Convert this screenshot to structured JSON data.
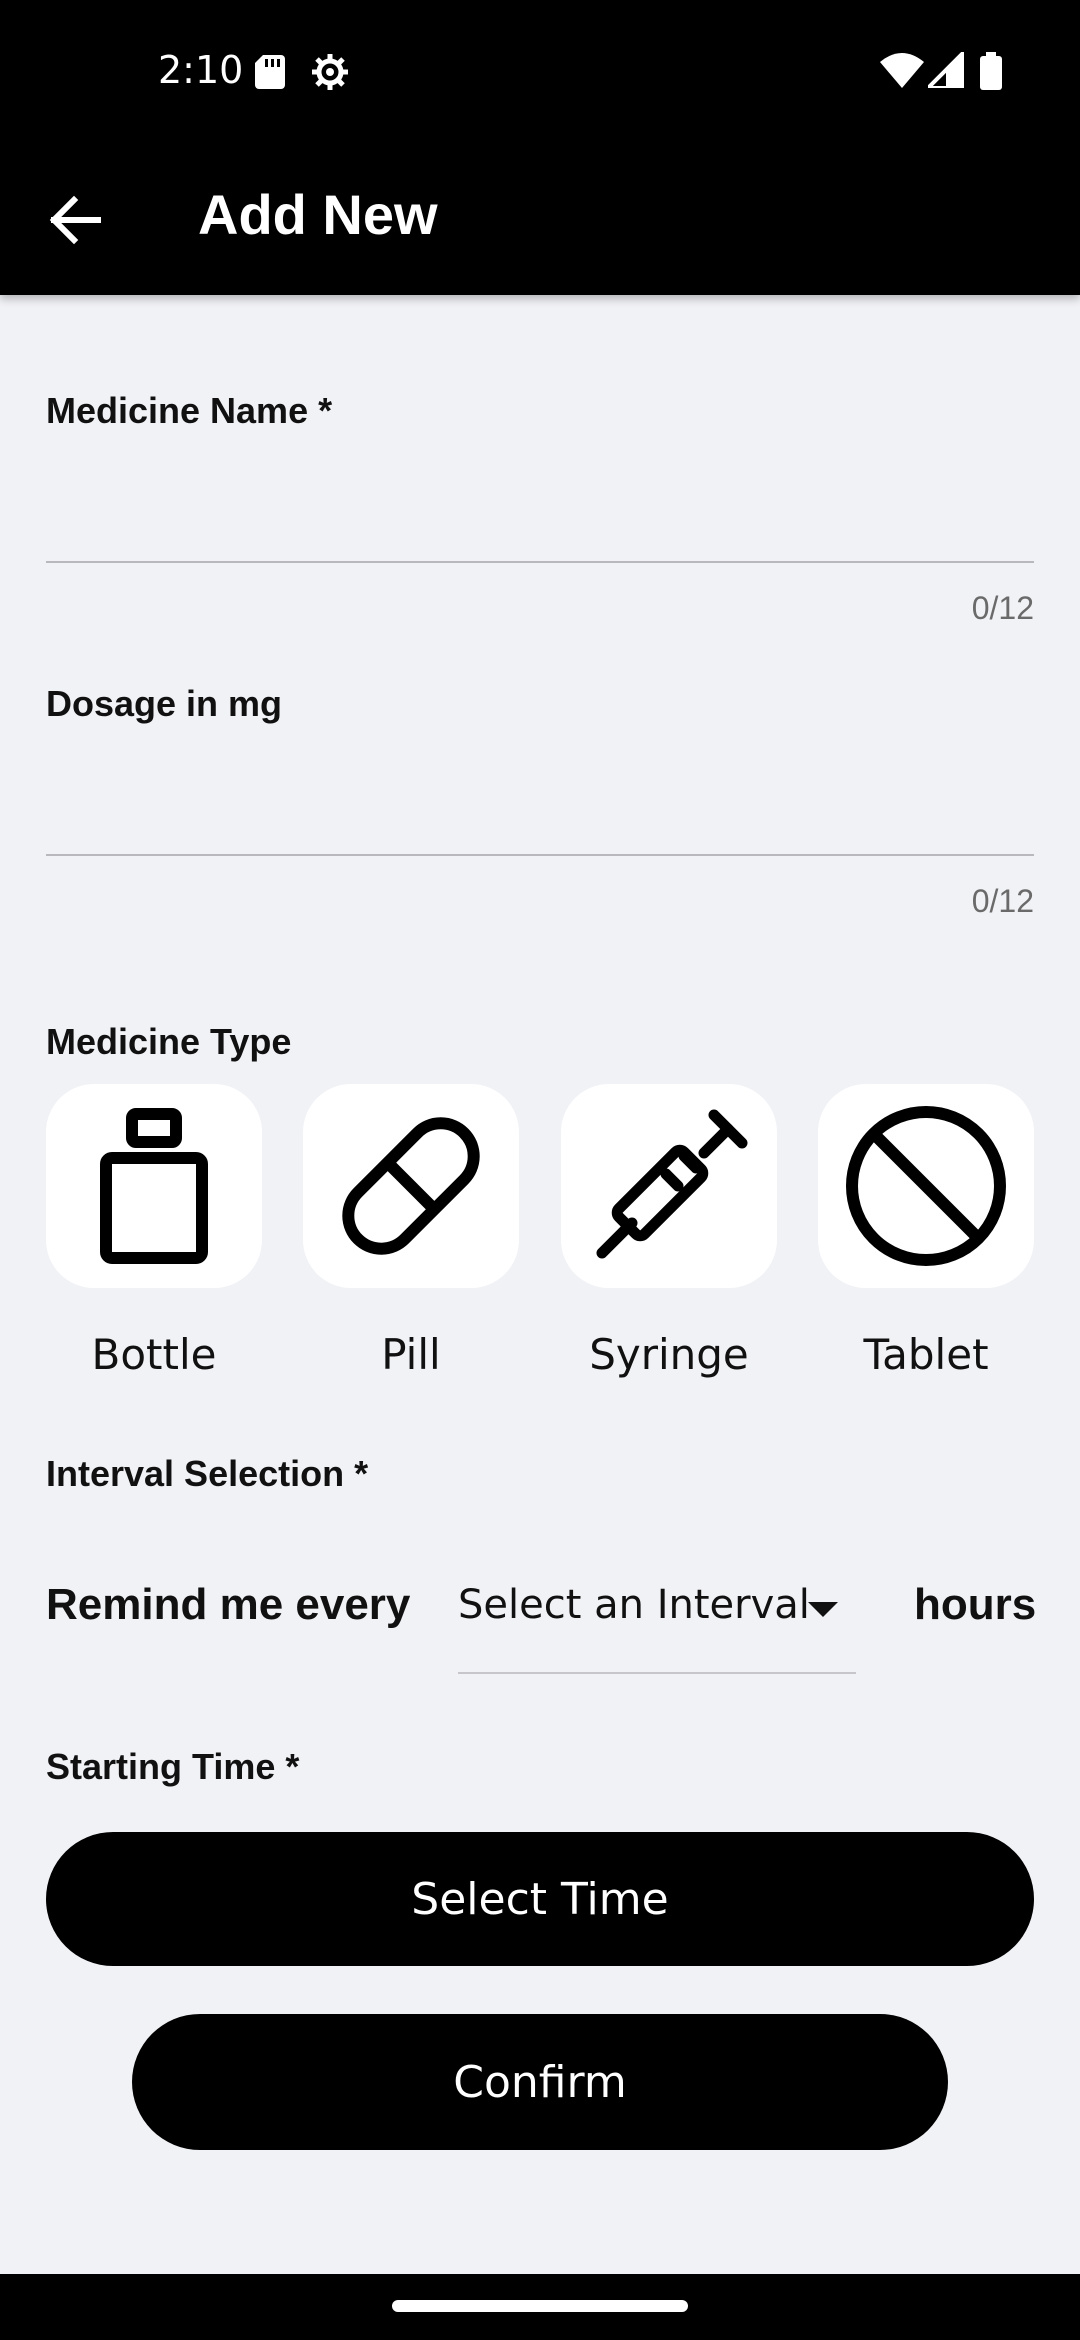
{
  "status_bar": {
    "time": "2:10"
  },
  "app_bar": {
    "title": "Add New"
  },
  "form": {
    "medicine_name": {
      "label": "Medicine Name *",
      "value": "",
      "counter": "0/12"
    },
    "dosage": {
      "label": "Dosage in mg",
      "value": "",
      "counter": "0/12"
    },
    "medicine_type": {
      "label": "Medicine Type",
      "options": [
        {
          "label": "Bottle",
          "icon": "bottle-icon"
        },
        {
          "label": "Pill",
          "icon": "pill-icon"
        },
        {
          "label": "Syringe",
          "icon": "syringe-icon"
        },
        {
          "label": "Tablet",
          "icon": "tablet-icon"
        }
      ]
    },
    "interval": {
      "label": "Interval Selection *",
      "prefix": "Remind me every",
      "select_value": "Select an Interval",
      "suffix": "hours"
    },
    "starting_time": {
      "label": "Starting Time *",
      "button": "Select Time"
    },
    "confirm_label": "Confirm"
  },
  "colors": {
    "background": "#f1f2f6",
    "bars": "#000000",
    "card": "#ffffff"
  }
}
